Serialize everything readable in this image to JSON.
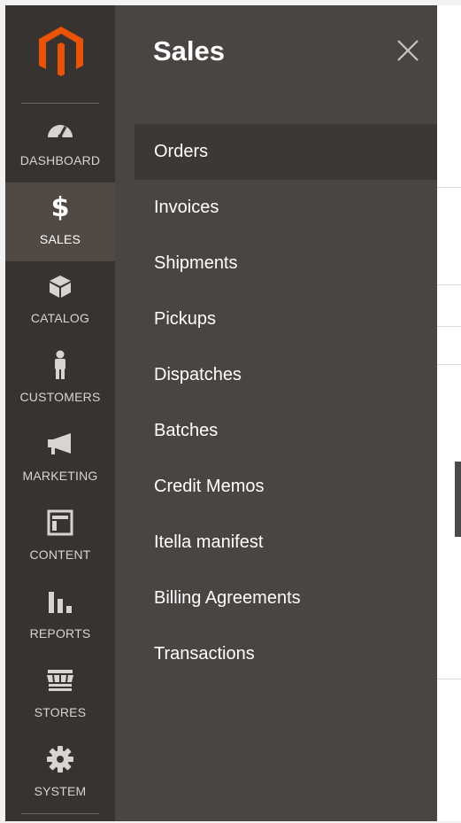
{
  "sidebar": {
    "items": [
      {
        "label": "DASHBOARD",
        "icon": "speedometer-icon"
      },
      {
        "label": "SALES",
        "icon": "dollar-icon"
      },
      {
        "label": "CATALOG",
        "icon": "box-icon"
      },
      {
        "label": "CUSTOMERS",
        "icon": "person-icon"
      },
      {
        "label": "MARKETING",
        "icon": "megaphone-icon"
      },
      {
        "label": "CONTENT",
        "icon": "layout-icon"
      },
      {
        "label": "REPORTS",
        "icon": "bar-chart-icon"
      },
      {
        "label": "STORES",
        "icon": "storefront-icon"
      },
      {
        "label": "SYSTEM",
        "icon": "gear-icon"
      }
    ],
    "active": "SALES"
  },
  "panel": {
    "title": "Sales",
    "items": [
      {
        "label": "Orders"
      },
      {
        "label": "Invoices"
      },
      {
        "label": "Shipments"
      },
      {
        "label": "Pickups"
      },
      {
        "label": "Dispatches"
      },
      {
        "label": "Batches"
      },
      {
        "label": "Credit Memos"
      },
      {
        "label": "Itella manifest"
      },
      {
        "label": "Billing Agreements"
      },
      {
        "label": "Transactions"
      }
    ],
    "active": "Orders"
  },
  "colors": {
    "sidebar_bg": "#373330",
    "sidebar_active_bg": "#514943",
    "panel_bg": "#4a4542",
    "panel_active_bg": "#3c3835",
    "brand_orange": "#eb5202"
  }
}
